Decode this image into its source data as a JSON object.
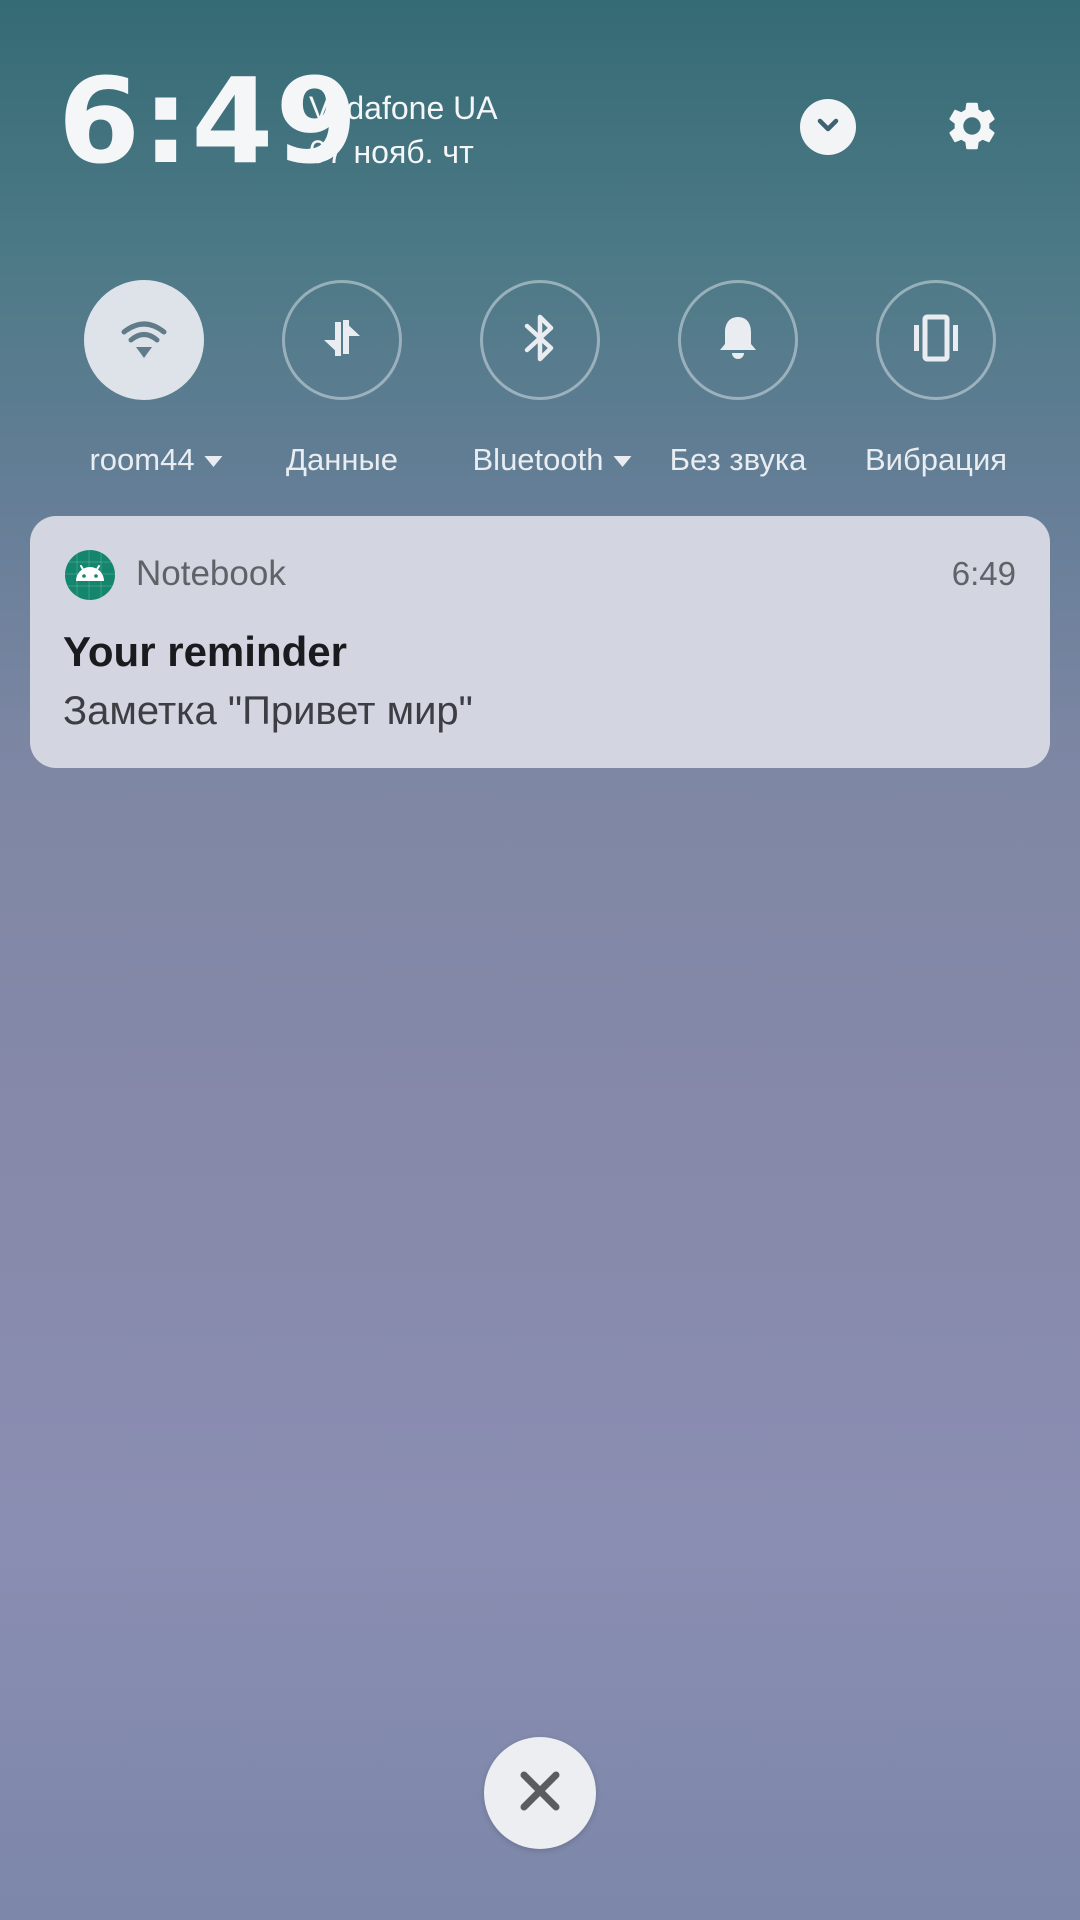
{
  "status": {
    "time": "6:49",
    "carrier": "Vodafone UA",
    "date": "07 нояб. чт"
  },
  "header_icons": {
    "expand": "chevron-down-icon",
    "settings": "gear-icon"
  },
  "quick_settings": [
    {
      "label": "room44",
      "icon": "wifi-icon",
      "active": true,
      "has_dropdown": true
    },
    {
      "label": "Данные",
      "icon": "mobile-data-icon",
      "active": false,
      "has_dropdown": false
    },
    {
      "label": "Bluetooth",
      "icon": "bluetooth-icon",
      "active": false,
      "has_dropdown": true
    },
    {
      "label": "Без звука",
      "icon": "bell-icon",
      "active": false,
      "has_dropdown": false
    },
    {
      "label": "Вибрация",
      "icon": "vibrate-icon",
      "active": false,
      "has_dropdown": false
    }
  ],
  "notification": {
    "app_name": "Notebook",
    "time": "6:49",
    "title": "Your reminder",
    "text": "Заметка \"Привет мир\"",
    "app_icon": "android-icon",
    "app_icon_color": "#14866d"
  },
  "close_button": {
    "icon": "close-icon"
  },
  "colors": {
    "notification_bg": "#d3d6e1",
    "tile_active_bg": "#dde3e8"
  }
}
